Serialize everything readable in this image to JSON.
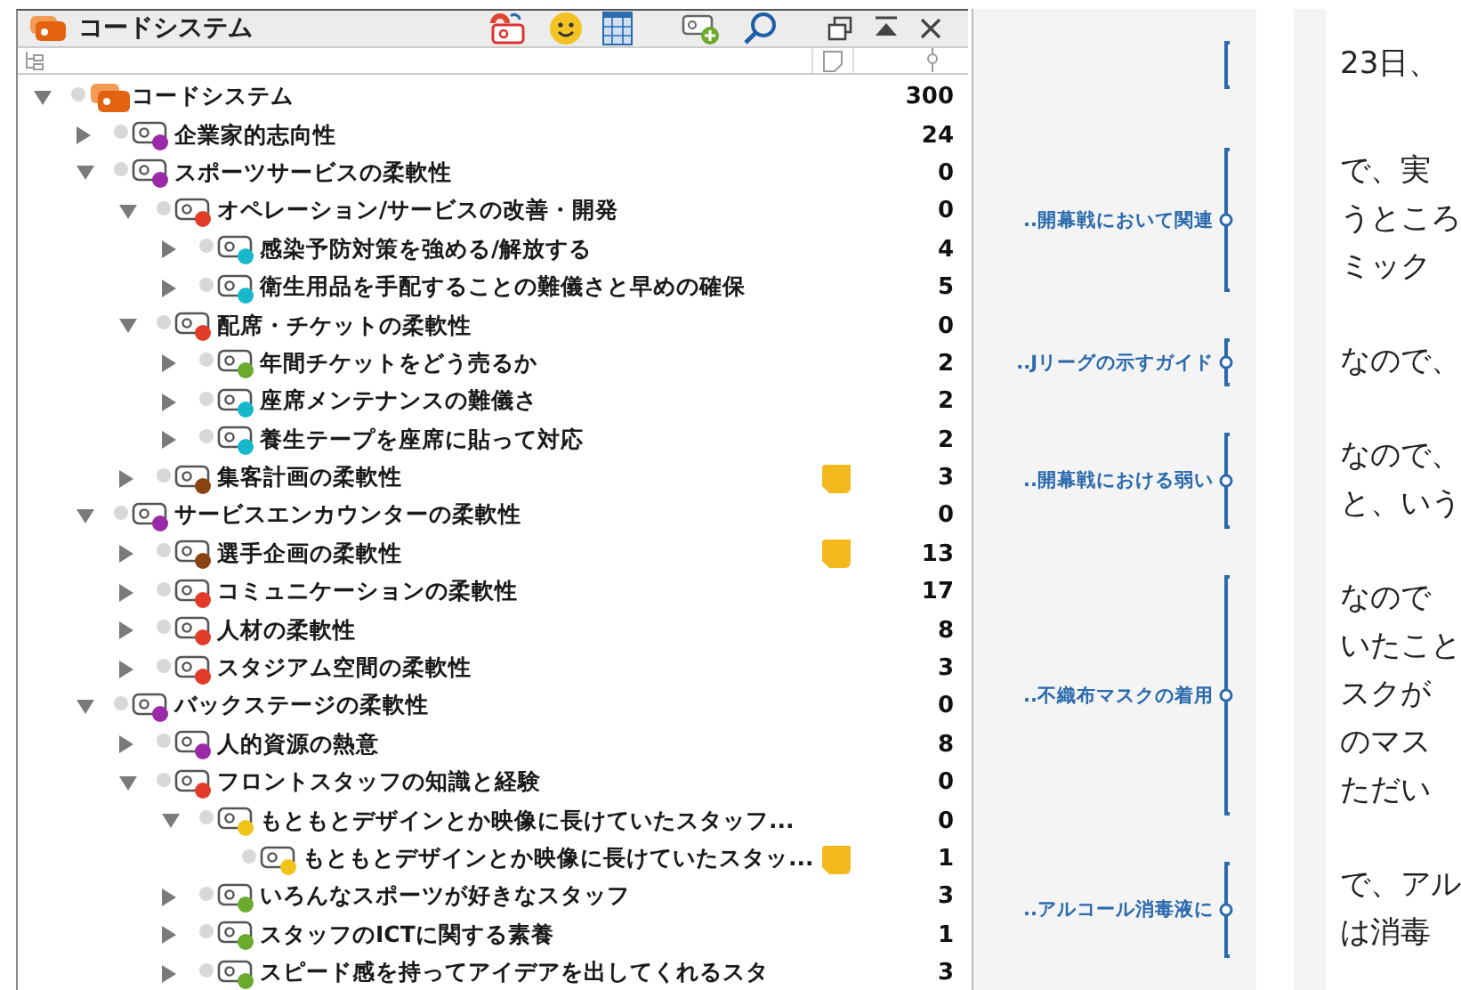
{
  "panel": {
    "title": "コードシステム"
  },
  "tree": [
    {
      "label": "コードシステム",
      "count": "300",
      "kind": "root",
      "expanded": true,
      "memo": false,
      "children": [
        {
          "label": "企業家的志向性",
          "count": "24",
          "kind": "code",
          "color": "#9b2aa8",
          "expanded": false,
          "memo": false
        },
        {
          "label": "スポーツサービスの柔軟性",
          "count": "0",
          "kind": "code",
          "color": "#9b2aa8",
          "expanded": true,
          "memo": false,
          "children": [
            {
              "label": "オペレーション/サービスの改善・開発",
              "count": "0",
              "kind": "code",
              "color": "#e23b2a",
              "expanded": true,
              "memo": false,
              "children": [
                {
                  "label": "感染予防対策を強める/解放する",
                  "count": "4",
                  "kind": "code",
                  "color": "#18b8cc",
                  "expanded": false,
                  "memo": false
                },
                {
                  "label": "衛生用品を手配することの難儀さと早めの確保",
                  "count": "5",
                  "kind": "code",
                  "color": "#18b8cc",
                  "expanded": false,
                  "memo": false
                }
              ]
            },
            {
              "label": "配席・チケットの柔軟性",
              "count": "0",
              "kind": "code",
              "color": "#e23b2a",
              "expanded": true,
              "memo": false,
              "children": [
                {
                  "label": "年間チケットをどう売るか",
                  "count": "2",
                  "kind": "code",
                  "color": "#6aab2e",
                  "expanded": false,
                  "memo": false
                },
                {
                  "label": "座席メンテナンスの難儀さ",
                  "count": "2",
                  "kind": "code",
                  "color": "#18b8cc",
                  "expanded": false,
                  "memo": false
                },
                {
                  "label": "養生テープを座席に貼って対応",
                  "count": "2",
                  "kind": "code",
                  "color": "#18b8cc",
                  "expanded": false,
                  "memo": false
                }
              ]
            },
            {
              "label": "集客計画の柔軟性",
              "count": "3",
              "kind": "code",
              "color": "#8a4414",
              "expanded": false,
              "memo": true
            }
          ]
        },
        {
          "label": "サービスエンカウンターの柔軟性",
          "count": "0",
          "kind": "code",
          "color": "#9b2aa8",
          "expanded": true,
          "memo": false,
          "children": [
            {
              "label": "選手企画の柔軟性",
              "count": "13",
              "kind": "code",
              "color": "#8a4414",
              "expanded": false,
              "memo": true
            },
            {
              "label": "コミュニケーションの柔軟性",
              "count": "17",
              "kind": "code",
              "color": "#e23b2a",
              "expanded": false,
              "memo": false
            },
            {
              "label": "人材の柔軟性",
              "count": "8",
              "kind": "code",
              "color": "#e23b2a",
              "expanded": false,
              "memo": false
            },
            {
              "label": "スタジアム空間の柔軟性",
              "count": "3",
              "kind": "code",
              "color": "#e23b2a",
              "expanded": false,
              "memo": false
            }
          ]
        },
        {
          "label": "バックステージの柔軟性",
          "count": "0",
          "kind": "code",
          "color": "#9b2aa8",
          "expanded": true,
          "memo": false,
          "children": [
            {
              "label": "人的資源の熱意",
              "count": "8",
              "kind": "code",
              "color": "#9b2aa8",
              "expanded": false,
              "memo": false
            },
            {
              "label": "フロントスタッフの知識と経験",
              "count": "0",
              "kind": "code",
              "color": "#e23b2a",
              "expanded": true,
              "memo": false,
              "children": [
                {
                  "label": "もともとデザインとか映像に長けていたスタッフ...",
                  "count": "0",
                  "kind": "code",
                  "color": "#f2c318",
                  "expanded": true,
                  "memo": false,
                  "children": [
                    {
                      "label": "もともとデザインとか映像に長けていたスタッ...",
                      "count": "1",
                      "kind": "code",
                      "color": "#f2c318",
                      "memo": true
                    }
                  ]
                },
                {
                  "label": "いろんなスポーツが好きなスタッフ",
                  "count": "3",
                  "kind": "code",
                  "color": "#6aab2e",
                  "expanded": false,
                  "memo": false
                },
                {
                  "label": "スタッフのICTに関する素養",
                  "count": "1",
                  "kind": "code",
                  "color": "#6aab2e",
                  "expanded": false,
                  "memo": false
                },
                {
                  "label": "スピード感を持ってアイデアを出してくれるスタ",
                  "count": "3",
                  "kind": "code",
                  "color": "#6aab2e",
                  "expanded": false,
                  "memo": false
                }
              ]
            }
          ]
        }
      ]
    }
  ],
  "document": {
    "segments": [
      {
        "lines": [
          "23日、"
        ]
      },
      {
        "code": "..開幕戦において関連",
        "lines": [
          "で、実",
          "うところ",
          "ミック"
        ]
      },
      {
        "code": "..Jリーグの示すガイド",
        "lines": [
          "なので、"
        ]
      },
      {
        "code": "..開幕戦における弱い",
        "lines": [
          "なので、",
          "と、いう"
        ]
      },
      {
        "code": "..不織布マスクの着用",
        "lines": [
          "なので",
          "いたこと",
          "スクが",
          "のマス",
          "ただい"
        ]
      },
      {
        "code": "..アルコール消毒液に",
        "lines": [
          "で、アル",
          "は消毒"
        ]
      }
    ]
  }
}
